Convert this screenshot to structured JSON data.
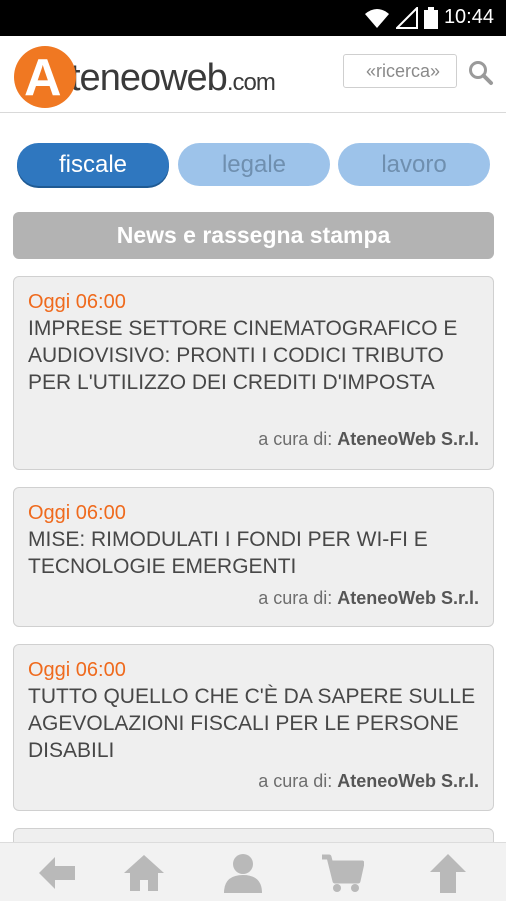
{
  "status_bar": {
    "time": "10:44"
  },
  "header": {
    "logo_letter": "A",
    "logo_text": "teneoweb",
    "logo_domain": ".com",
    "search_placeholder": "«ricerca»"
  },
  "tabs": [
    {
      "label": "fiscale",
      "active": true
    },
    {
      "label": "legale",
      "active": false
    },
    {
      "label": "lavoro",
      "active": false
    }
  ],
  "section_title": "News e rassegna stampa",
  "news": [
    {
      "time": "Oggi 06:00",
      "title": "IMPRESE SETTORE CINEMATOGRAFICO E AUDIOVISIVO: PRONTI I CODICI TRIBUTO PER L'UTILIZZO DEI CREDITI D'IMPOSTA",
      "author_prefix": "a cura di:",
      "author": "AteneoWeb S.r.l."
    },
    {
      "time": "Oggi 06:00",
      "title": "MISE: RIMODULATI I FONDI PER WI-FI E TECNOLOGIE EMERGENTI",
      "author_prefix": "a cura di:",
      "author": "AteneoWeb S.r.l."
    },
    {
      "time": "Oggi 06:00",
      "title": "TUTTO QUELLO CHE C'È DA SAPERE SULLE AGEVOLAZIONI FISCALI PER LE PERSONE DISABILI",
      "author_prefix": "a cura di:",
      "author": "AteneoWeb S.r.l."
    }
  ],
  "bottom_nav": [
    {
      "icon": "back-arrow-icon"
    },
    {
      "icon": "home-icon"
    },
    {
      "icon": "user-icon"
    },
    {
      "icon": "cart-icon"
    },
    {
      "icon": "up-arrow-icon"
    }
  ],
  "colors": {
    "accent_orange": "#f07822",
    "tab_active": "#2f77bf",
    "tab_inactive": "#9dc3ea",
    "section_header": "#b3b3b3"
  }
}
